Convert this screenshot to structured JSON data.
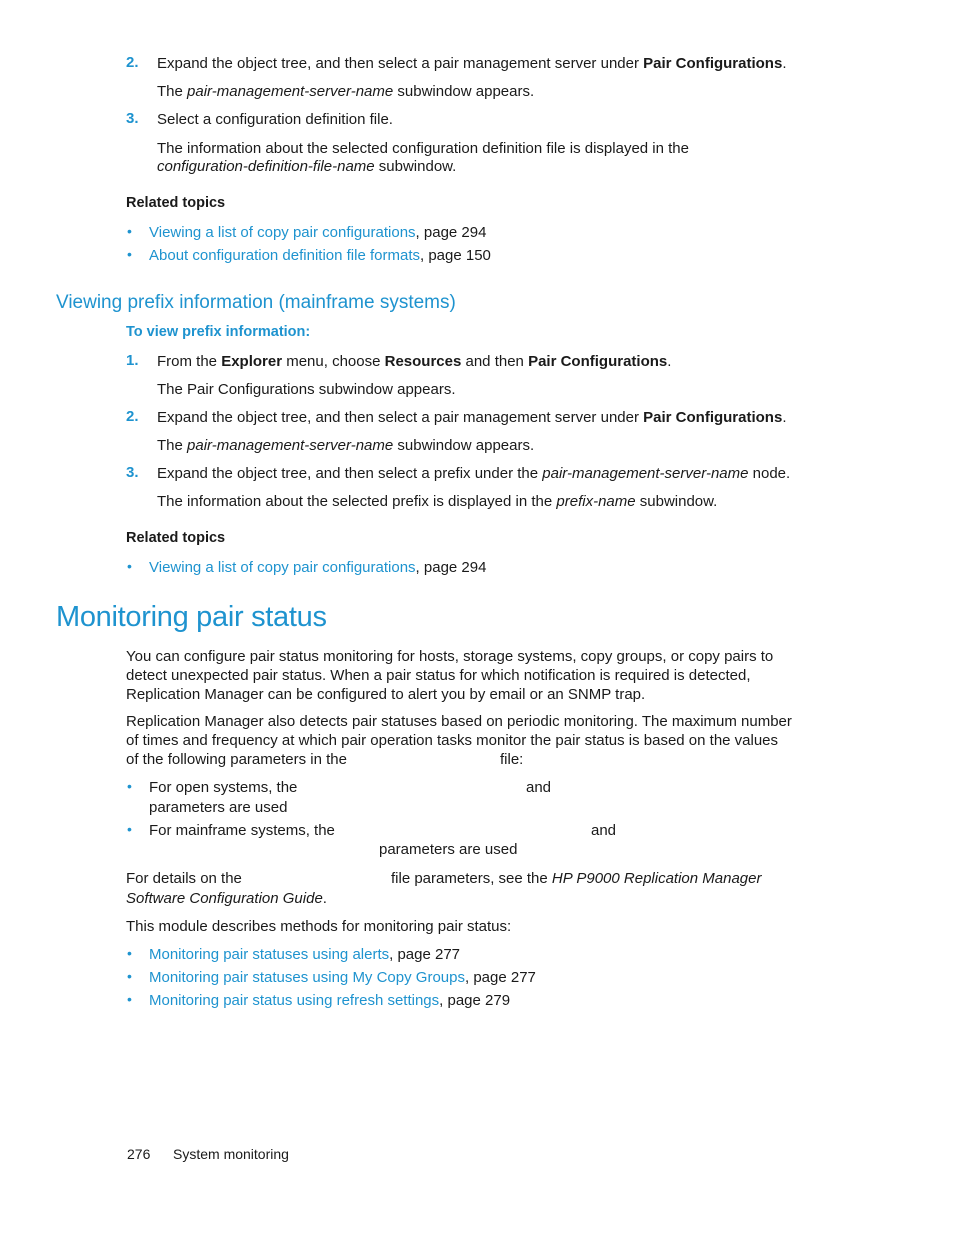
{
  "top_steps": [
    {
      "number": "2.",
      "text_before": "Expand the object tree, and then select a pair management server under ",
      "bold": "Pair Configurations",
      "text_after": ".",
      "result_prefix": "The ",
      "result_italic": "pair-management-server-name",
      "result_suffix": " subwindow appears."
    },
    {
      "number": "3.",
      "text": "Select a configuration definition file.",
      "result_line1": "The information about the selected configuration definition file is displayed in the",
      "result_italic": "configuration-definition-file-name",
      "result_suffix": " subwindow."
    }
  ],
  "related_topics_1": {
    "heading": "Related topics",
    "items": [
      {
        "link": "Viewing a list of copy pair configurations",
        "page": ", page 294"
      },
      {
        "link": "About configuration definition file formats",
        "page": ", page 150"
      }
    ]
  },
  "section_prefix": {
    "title": "Viewing prefix information (mainframe systems)",
    "procedure_heading": "To view prefix information:",
    "steps": [
      {
        "number": "1.",
        "t1": "From the ",
        "b1": "Explorer",
        "t2": " menu, choose ",
        "b2": "Resources",
        "t3": " and then ",
        "b3": "Pair Configurations",
        "t4": ".",
        "result": "The Pair Configurations subwindow appears."
      },
      {
        "number": "2.",
        "t1": "Expand the object tree, and then select a pair management server under ",
        "b1": "Pair Configurations",
        "t2": ".",
        "result_prefix": "The ",
        "result_italic": "pair-management-server-name",
        "result_suffix": " subwindow appears."
      },
      {
        "number": "3.",
        "t1": "Expand the object tree, and then select a prefix under the ",
        "i1": "pair-management-server-name",
        "t2": " node.",
        "result_prefix": "The information about the selected prefix is displayed in the ",
        "result_italic": "prefix-name",
        "result_suffix": " subwindow."
      }
    ],
    "related_heading": "Related topics",
    "related_items": [
      {
        "link": "Viewing a list of copy pair configurations",
        "page": ", page 294"
      }
    ]
  },
  "section_monitoring": {
    "title": "Monitoring pair status",
    "para1_lines": [
      "You can configure pair status monitoring for hosts, storage systems, copy groups, or copy pairs to",
      "detect unexpected pair status. When a pair status for which notification is required is detected,",
      "Replication Manager can be configured to alert you by email or an SNMP trap."
    ],
    "para2_lines": [
      "Replication Manager also detects pair statuses based on periodic monitoring. The maximum number",
      "of times and frequency at which pair operation tasks monitor the pair status is based on the values",
      "of the following parameters in the"
    ],
    "para2_file": "file:",
    "bullets": [
      {
        "lead": "For open systems, the",
        "and": "and",
        "tail": "parameters are used"
      },
      {
        "lead": "For mainframe systems, the",
        "and": "and",
        "tail": "parameters are used"
      }
    ],
    "details_lead": "For details on the",
    "details_mid": "file parameters, see the ",
    "details_italic_1": "HP P9000 Replication Manager",
    "details_italic_2": "Software Configuration Guide",
    "details_end": ".",
    "module_intro": "This module describes methods for monitoring pair status:",
    "module_links": [
      {
        "link": "Monitoring pair statuses using alerts",
        "page": ", page 277"
      },
      {
        "link": "Monitoring pair statuses using My Copy Groups",
        "page": ", page 277"
      },
      {
        "link": "Monitoring pair status using refresh settings",
        "page": ", page 279"
      }
    ]
  },
  "footer": {
    "page_number": "276",
    "section": "System monitoring"
  },
  "colors": {
    "accent": "#1e93cf",
    "text": "#1a1a1a"
  }
}
